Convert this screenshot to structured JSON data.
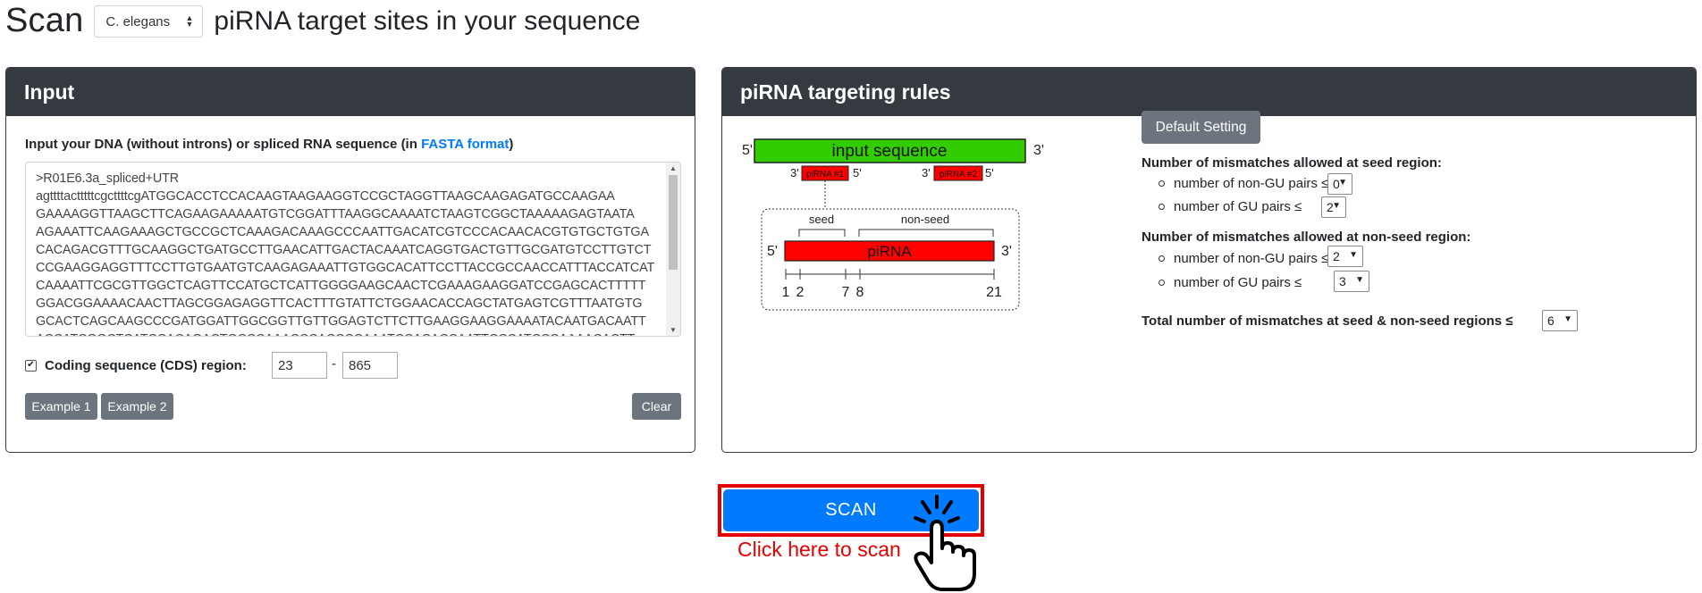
{
  "header": {
    "scan_word": "Scan",
    "species_selected": "C. elegans",
    "title": "piRNA target sites in your sequence"
  },
  "input_card": {
    "title": "Input",
    "label_prefix": "Input your DNA (without introns) or spliced RNA sequence (in ",
    "label_link": "FASTA format",
    "label_suffix": ")",
    "sequence_lines": [
      ">R01E6.3a_spliced+UTR",
      "agttttactttttcgcttttcgATGGCACCTCCACAAGTAAGAAGGTCCGCTAGGTTAAGCAAGAGATGCCAAGAA",
      "GAAAAGGTTAAGCTTCAGAAGAAAAATGTCGGATTTAAGGCAAAATCTAAGTCGGCTAAAAAGAGTAATA",
      "AGAAATTCAAGAAAGCTGCCGCTCAAAGACAAAGCCCAATTGACATCGTCCCACAACACGTGTGCTGTGA",
      "CACAGACGTTTGCAAGGCTGATGCCTTGAACATTGACTACAAATCAGGTGACTGTTGCGATGTCCTTGTCT",
      "CCGAAGGAGGTTTCCTTGTGAATGTCAAGAGAAATTGTGGCACATTCCTTACCGCCAACCATTTACCATCAT",
      "CAAAATTCGCGTTGGCTCAGTTCCATGCTCATTGGGGAAGCAACTCGAAAGAAGGATCCGAGCACTTTTT",
      "GGACGGAAAACAACTTAGCGGAGAGGTTCACTTTGTATTCTGGAACACCAGCTATGAGTCGTTTAATGTG",
      "GCACTCAGCAAGCCCGATGGATTGGCGGTTGTTGGAGTCTTCTTGAAGGAAGGAAAATACAATGACAATT",
      "ACCATCGGCTCATCCACAGACTGCCCAAACCCACCCCAAATCCACACCAATTCCCATCCCAAAACACTT"
    ],
    "cds_label": "Coding sequence (CDS) region:",
    "cds_start": "23",
    "cds_end": "865",
    "example1": "Example 1",
    "example2": "Example 2",
    "clear": "Clear"
  },
  "rules_card": {
    "title": "piRNA targeting rules",
    "diagram": {
      "five_prime": "5'",
      "three_prime": "3'",
      "input_sequence": "input sequence",
      "pirna1": "piRNA #1",
      "pirna2": "piRNA #2",
      "seed": "seed",
      "non_seed": "non-seed",
      "pirna": "piRNA",
      "pos1": "1",
      "pos2": "2",
      "pos7": "7",
      "pos8": "8",
      "pos21": "21"
    },
    "default_setting": "Default Setting",
    "seed_heading": "Number of mismatches allowed at seed region:",
    "nonseed_heading": "Number of mismatches allowed at non-seed region:",
    "non_gu_label": "number of non-GU pairs  ≤",
    "gu_label": "number of GU pairs  ≤",
    "seed_non_gu": "0",
    "seed_gu": "2",
    "nonseed_non_gu": "2",
    "nonseed_gu": "3",
    "total_label": "Total number of mismatches at seed & non-seed regions ≤",
    "total_value": "6"
  },
  "scan": {
    "button": "SCAN",
    "hint": "Click here to scan"
  },
  "colors": {
    "dark_header": "#343a40",
    "primary": "#007bff",
    "secondary": "#6c757d",
    "highlight_red": "#e40000",
    "input_green": "#33cc00",
    "pirna_red": "#ff0000"
  },
  "icons": [
    "select-arrows-icon",
    "checkbox-checked-icon",
    "dropdown-triangle-icon",
    "pointing-hand-icon"
  ]
}
